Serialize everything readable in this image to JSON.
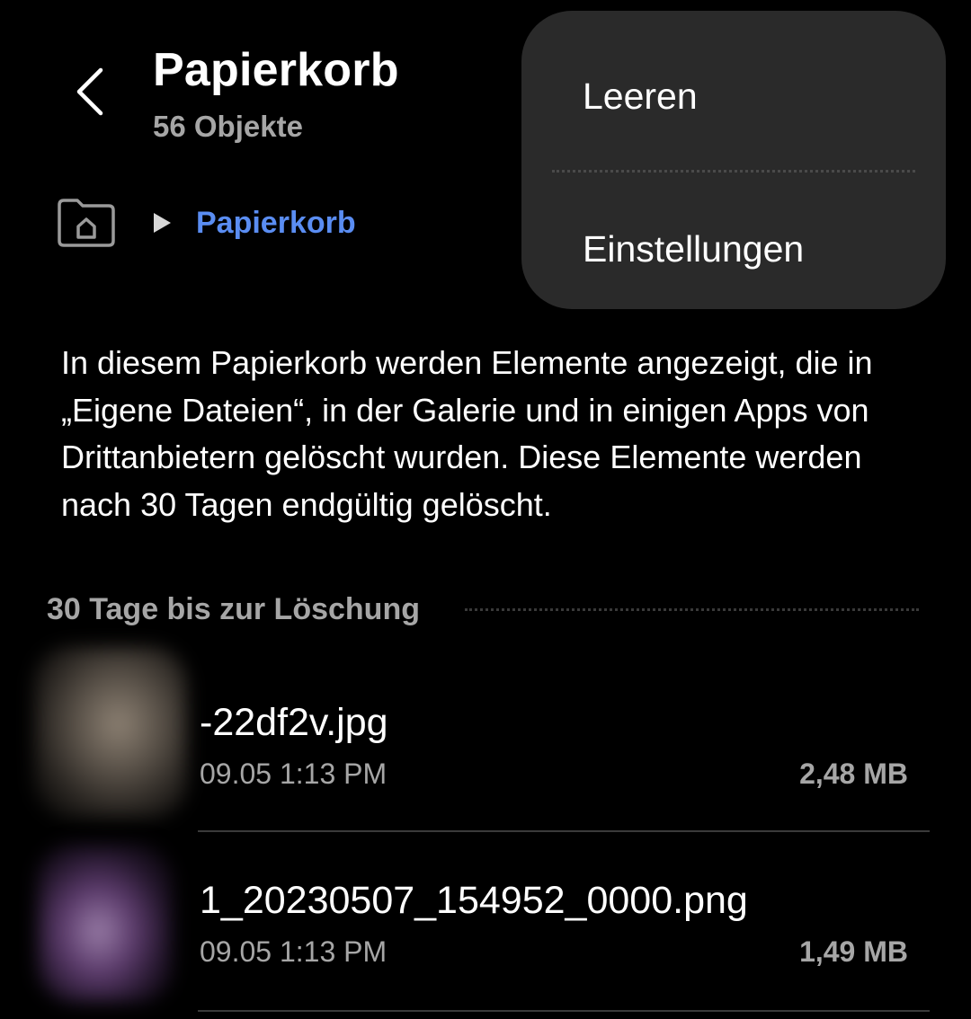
{
  "header": {
    "title": "Papierkorb",
    "subtitle": "56 Objekte",
    "back_icon": "chevron-left-icon"
  },
  "breadcrumb": {
    "home_icon": "home-folder-icon",
    "separator_icon": "triangle-right-icon",
    "current": "Papierkorb",
    "current_color": "#5a8df2"
  },
  "menu": {
    "items": [
      {
        "label": "Leeren"
      },
      {
        "label": "Einstellungen"
      }
    ],
    "background": "#2a2a2a"
  },
  "info_text": "In diesem Papierkorb werden Elemente angezeigt, die in „Eigene Dateien“, in der Galerie und in einigen Apps von Drittanbietern gelöscht wurden. Diese Elemente werden nach 30 Tagen endgültig gelöscht.",
  "section": {
    "title": "30 Tage bis zur Löschung"
  },
  "files": [
    {
      "name": "-22df2v.jpg",
      "date": "09.05 1:13 PM",
      "size": "2,48 MB"
    },
    {
      "name": "1_20230507_154952_0000.png",
      "date": "09.05 1:13 PM",
      "size": "1,49 MB"
    }
  ],
  "colors": {
    "background": "#000000",
    "primary_text": "#ffffff",
    "secondary_text": "#a6a6a6"
  }
}
